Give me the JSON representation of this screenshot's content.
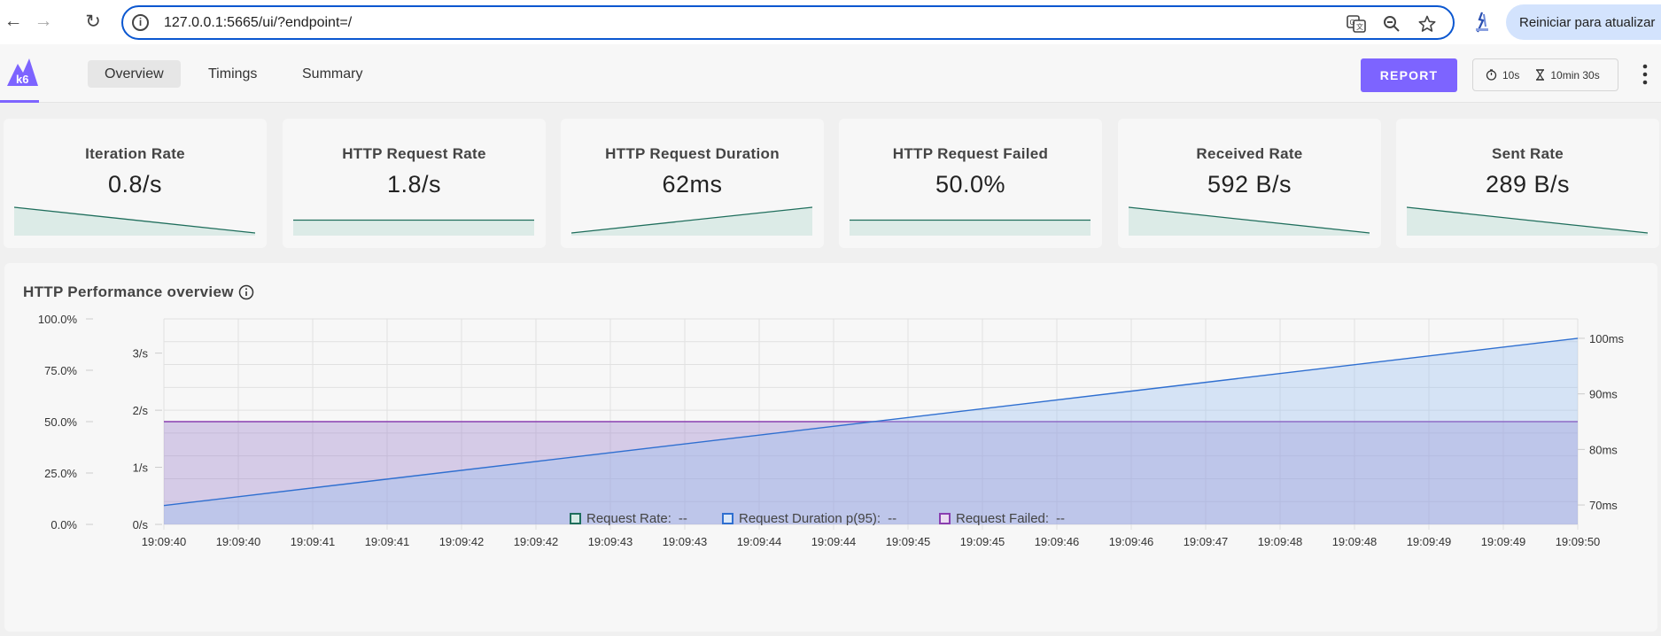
{
  "browser": {
    "url": "127.0.0.1:5665/ui/?endpoint=/",
    "update_label": "Reiniciar para atualizar"
  },
  "app": {
    "tabs": [
      {
        "label": "Overview",
        "active": true
      },
      {
        "label": "Timings",
        "active": false
      },
      {
        "label": "Summary",
        "active": false
      }
    ],
    "report_label": "REPORT",
    "refresh_interval": "10s",
    "duration": "10min 30s",
    "logo_text": "k6",
    "accent_color": "#7d64ff"
  },
  "stats": [
    {
      "title": "Iteration Rate",
      "value": "0.8/s",
      "trend": [
        1.0,
        0.0
      ]
    },
    {
      "title": "HTTP Request Rate",
      "value": "1.8/s",
      "trend": [
        0.5,
        0.5
      ]
    },
    {
      "title": "HTTP Request Duration",
      "value": "62ms",
      "trend": [
        0.0,
        1.0
      ]
    },
    {
      "title": "HTTP Request Failed",
      "value": "50.0%",
      "trend": [
        0.5,
        0.5
      ]
    },
    {
      "title": "Received Rate",
      "value": "592 B/s",
      "trend": [
        1.0,
        0.0
      ]
    },
    {
      "title": "Sent Rate",
      "value": "289 B/s",
      "trend": [
        1.0,
        0.0
      ]
    }
  ],
  "chart": {
    "title": "HTTP Performance overview",
    "legend": [
      {
        "label": "Request Rate:",
        "value": "--",
        "color": "#1f6e5c"
      },
      {
        "label": "Request Duration p(95):",
        "value": "--",
        "color": "#2f6fd0"
      },
      {
        "label": "Request Failed:",
        "value": "--",
        "color": "#8a3fb0"
      }
    ]
  },
  "chart_data": {
    "type": "area",
    "title": "HTTP Performance overview",
    "x": [
      "19:09:40",
      "19:09:40",
      "19:09:41",
      "19:09:41",
      "19:09:42",
      "19:09:42",
      "19:09:43",
      "19:09:43",
      "19:09:44",
      "19:09:44",
      "19:09:45",
      "19:09:45",
      "19:09:46",
      "19:09:46",
      "19:09:47",
      "19:09:48",
      "19:09:48",
      "19:09:49",
      "19:09:49",
      "19:09:50"
    ],
    "y_left_percent": {
      "ticks": [
        "100.0%",
        "75.0%",
        "50.0%",
        "25.0%",
        "0.0%"
      ],
      "range": [
        0,
        100
      ]
    },
    "y_left_rate": {
      "ticks": [
        "3/s",
        "2/s",
        "1/s",
        "0/s"
      ],
      "range": [
        0,
        3.6
      ]
    },
    "y_right_duration": {
      "ticks": [
        "100ms",
        "90ms",
        "80ms",
        "70ms"
      ],
      "range": [
        66.5,
        103.5
      ]
    },
    "series": [
      {
        "name": "Request Failed",
        "axis": "percent",
        "color": "#8a3fb0",
        "x_range": [
          0,
          1
        ],
        "values": [
          50.0,
          50.0
        ]
      },
      {
        "name": "Request Duration p(95)",
        "axis": "duration",
        "color": "#2f6fd0",
        "x_range": [
          0,
          1
        ],
        "values": [
          69.9,
          100.0
        ]
      }
    ],
    "grid": true
  }
}
